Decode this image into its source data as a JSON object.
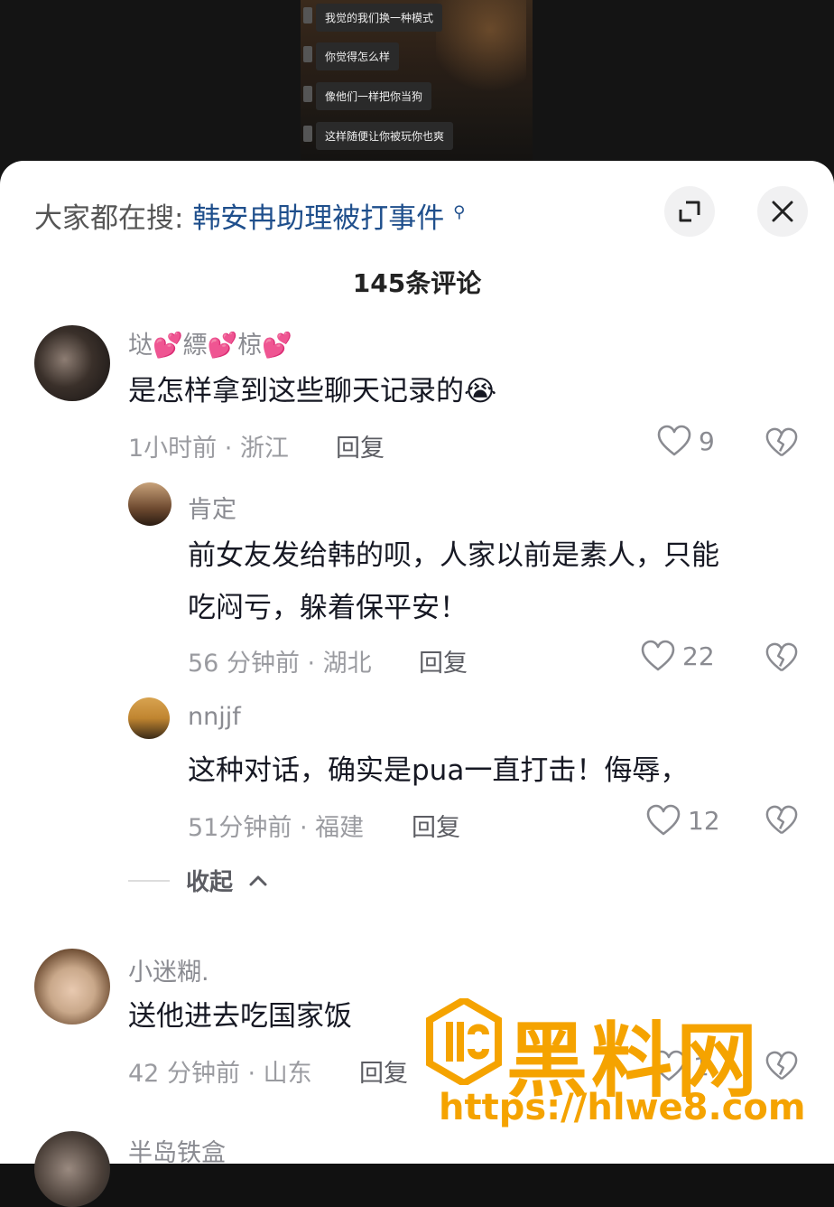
{
  "video": {
    "chat_lines": [
      "我觉的我们换一种模式",
      "你觉得怎么样",
      "像他们一样把你当狗",
      "这样随便让你被玩你也爽"
    ]
  },
  "sheet": {
    "search_prefix": "大家都在搜:",
    "search_term": "韩安冉助理被打事件",
    "title": "145条评论"
  },
  "comments": [
    {
      "user": "垯💕縹💕椋💕",
      "text": "是怎样拿到这些聊天记录的😭",
      "meta": "1小时前 · 浙江",
      "reply": "回复",
      "likes": "9"
    },
    {
      "user": "肯定",
      "text_line1": "前女友发给韩的呗，人家以前是素人，只能",
      "text_line2": "吃闷亏，躲着保平安！",
      "meta": "56 分钟前 · 湖北",
      "reply": "回复",
      "likes": "22"
    },
    {
      "user": "nnjjf",
      "text": "这种对话，确实是pua一直打击！侮辱，",
      "meta": "51分钟前 · 福建",
      "reply": "回复",
      "likes": "12"
    },
    {
      "user": "小迷糊.",
      "text": "送他进去吃国家饭",
      "meta": "42 分钟前 · 山东",
      "reply": "回复",
      "likes": "1"
    },
    {
      "user": "半岛铁盒"
    }
  ],
  "collapse_label": "收起",
  "watermark": {
    "title": "黑料网",
    "url": "https://hlwe8.com"
  }
}
